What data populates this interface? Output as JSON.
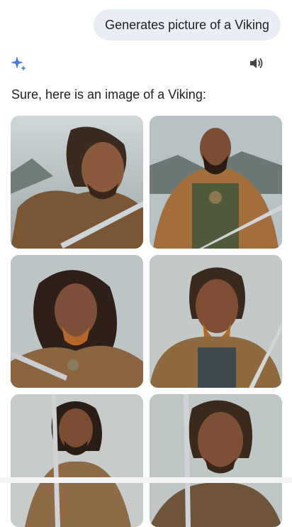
{
  "conversation": {
    "user_prompt": "Generates picture of a Viking",
    "reply_text": "Sure, here is an image of a Viking:"
  },
  "icons": {
    "assistant": "sparkle-icon",
    "read_aloud": "speaker-icon"
  },
  "colors": {
    "user_bubble": "#e9eef6",
    "sparkle": "#4d7bd6"
  },
  "images": [
    {
      "name": "viking-image-1"
    },
    {
      "name": "viking-image-2"
    },
    {
      "name": "viking-image-3"
    },
    {
      "name": "viking-image-4"
    },
    {
      "name": "viking-image-5"
    },
    {
      "name": "viking-image-6"
    }
  ]
}
